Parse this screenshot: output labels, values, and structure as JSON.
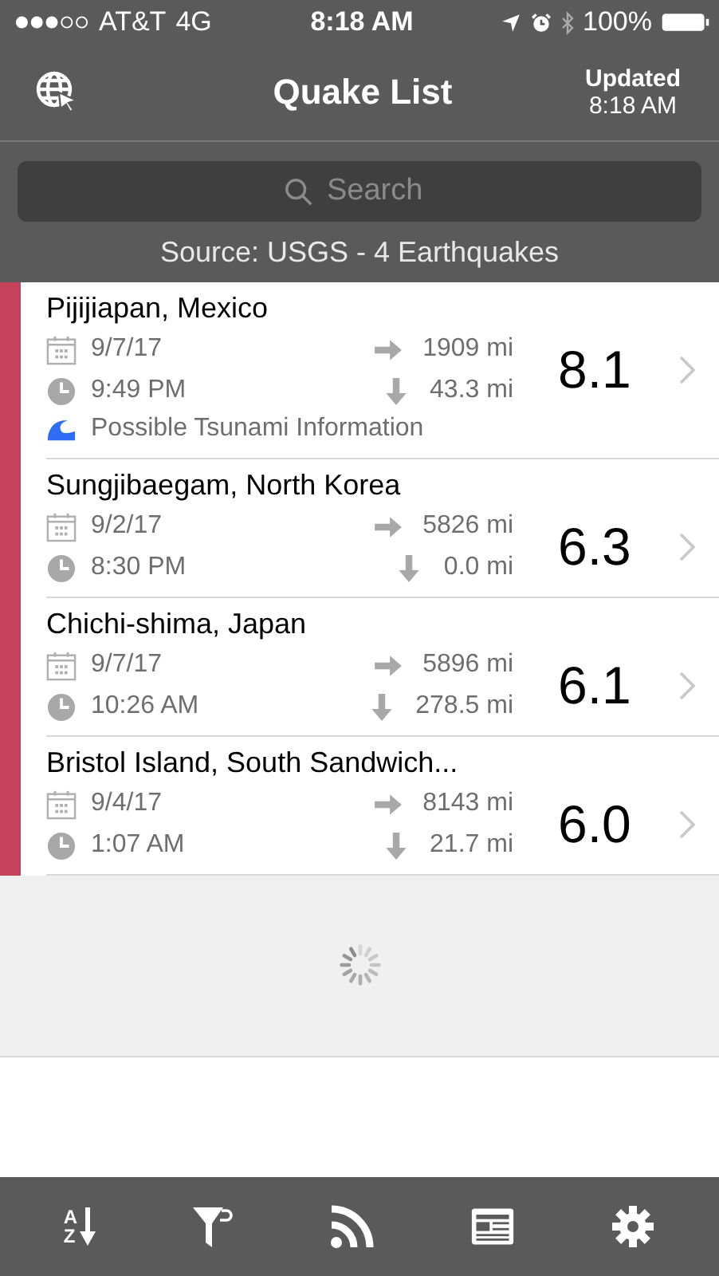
{
  "status_bar": {
    "carrier": "AT&T",
    "network": "4G",
    "time": "8:18 AM",
    "battery": "100%"
  },
  "nav": {
    "title": "Quake List",
    "updated_label": "Updated",
    "updated_time": "8:18 AM"
  },
  "search": {
    "placeholder": "Search"
  },
  "source": "Source: USGS - 4 Earthquakes",
  "quakes": [
    {
      "place": "Pijijiapan, Mexico",
      "date": "9/7/17",
      "time": "9:49 PM",
      "distance": "1909 mi",
      "depth": "43.3 mi",
      "magnitude": "8.1",
      "color": "#c4435b",
      "tsunami": "Possible Tsunami Information"
    },
    {
      "place": "Sungjibaegam, North Korea",
      "date": "9/2/17",
      "time": "8:30 PM",
      "distance": "5826 mi",
      "depth": "0.0 mi",
      "magnitude": "6.3",
      "color": "#c4435b"
    },
    {
      "place": "Chichi-shima, Japan",
      "date": "9/7/17",
      "time": "10:26 AM",
      "distance": "5896 mi",
      "depth": "278.5 mi",
      "magnitude": "6.1",
      "color": "#c4435b"
    },
    {
      "place": "Bristol Island, South Sandwich...",
      "date": "9/4/17",
      "time": "1:07 AM",
      "distance": "8143 mi",
      "depth": "21.7 mi",
      "magnitude": "6.0",
      "color": "#c4435b"
    }
  ],
  "loading": true,
  "tab_bar": [
    {
      "kind": "sort",
      "letters": [
        "A",
        "Z"
      ]
    },
    {
      "kind": "filter"
    },
    {
      "kind": "feed"
    },
    {
      "kind": "news"
    },
    {
      "kind": "settings"
    }
  ]
}
